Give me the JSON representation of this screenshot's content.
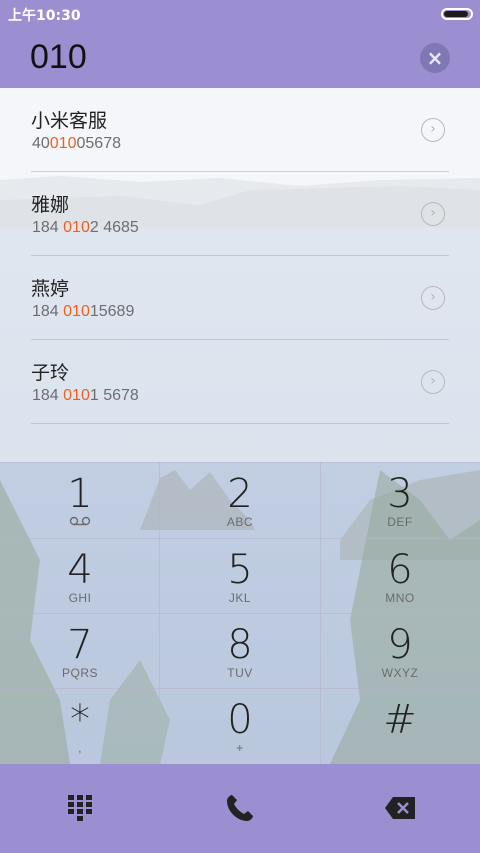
{
  "status_bar": {
    "time": "上午10:30"
  },
  "search": {
    "query": "010",
    "clear_icon": "clear-icon"
  },
  "results": [
    {
      "name": "小米客服",
      "number_pre": "40",
      "number_match": "010",
      "number_post": "05678"
    },
    {
      "name": "雅娜",
      "number_pre": "184 ",
      "number_match": "010",
      "number_post": "2 4685"
    },
    {
      "name": "燕婷",
      "number_pre": "184 ",
      "number_match": "010",
      "number_post": "15689"
    },
    {
      "name": "子玲",
      "number_pre": "184 ",
      "number_match": "010",
      "number_post": "1 5678"
    }
  ],
  "keypad": {
    "keys": [
      {
        "digit": "1",
        "letters": ""
      },
      {
        "digit": "2",
        "letters": "ABC"
      },
      {
        "digit": "3",
        "letters": "DEF"
      },
      {
        "digit": "4",
        "letters": "GHI"
      },
      {
        "digit": "5",
        "letters": "JKL"
      },
      {
        "digit": "6",
        "letters": "MNO"
      },
      {
        "digit": "7",
        "letters": "PQRS"
      },
      {
        "digit": "8",
        "letters": "TUV"
      },
      {
        "digit": "9",
        "letters": "WXYZ"
      },
      {
        "digit": "*",
        "letters": ","
      },
      {
        "digit": "0",
        "letters": "+"
      },
      {
        "digit": "#",
        "letters": ""
      }
    ]
  },
  "bottom_bar": {
    "left_icon": "dialpad-icon",
    "center_icon": "phone-call-icon",
    "right_icon": "backspace-icon"
  },
  "colors": {
    "accent": "#9b8fd2",
    "match_highlight": "#f25f1c"
  }
}
